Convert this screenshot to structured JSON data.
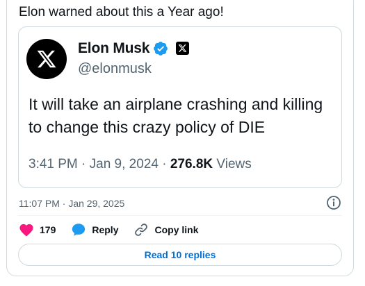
{
  "tweet": {
    "text": "Elon warned about this a Year ago!",
    "timestamp": "11:07 PM · Jan 29, 2025"
  },
  "embedded": {
    "author_name": "Elon Musk",
    "author_handle": "@elonmusk",
    "text_line1": "It will take an airplane crashing and killing",
    "text_line2": "to change this crazy policy of DIE",
    "time": "3:41 PM · Jan 9, 2024 · ",
    "views_count": "276.8K",
    "views_label": " Views",
    "avatar_icon": "x-logo-icon",
    "verified_icon": "verified-badge-icon",
    "affiliate_icon": "x-affiliate-badge-icon"
  },
  "actions": {
    "likes_count": "179",
    "reply_label": "Reply",
    "copy_link_label": "Copy link"
  },
  "read_replies_label": "Read 10 replies",
  "colors": {
    "like": "#f91880",
    "reply": "#1d9bf0",
    "link_text": "#006fd6",
    "verified": "#1d9bf0",
    "border": "#cfd9de",
    "secondary_text": "#536471"
  }
}
